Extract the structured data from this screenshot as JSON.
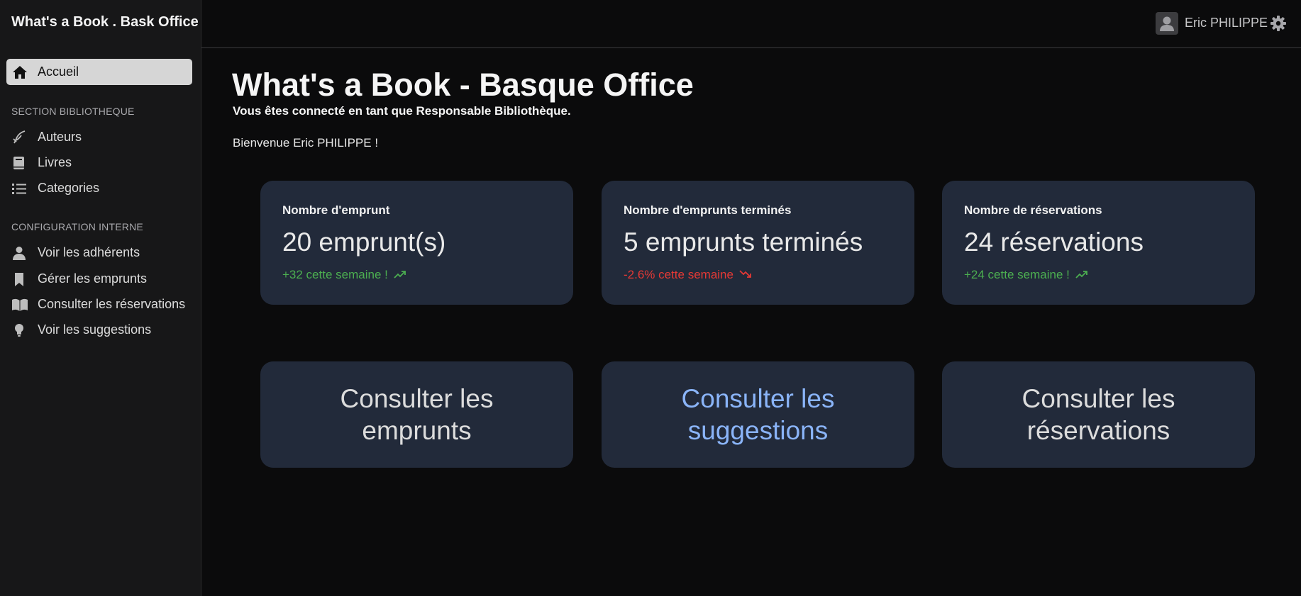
{
  "brand": "What's a Book . Bask Office",
  "sidebar": {
    "active": {
      "label": "Accueil",
      "icon": "home-icon"
    },
    "sections": [
      {
        "title": "SECTION BIBLIOTHEQUE",
        "items": [
          {
            "label": "Auteurs",
            "icon": "quill-icon"
          },
          {
            "label": "Livres",
            "icon": "book-icon"
          },
          {
            "label": "Categories",
            "icon": "list-icon"
          }
        ]
      },
      {
        "title": "CONFIGURATION INTERNE",
        "items": [
          {
            "label": "Voir les adhérents",
            "icon": "person-icon"
          },
          {
            "label": "Gérer les emprunts",
            "icon": "bookmark-icon"
          },
          {
            "label": "Consulter les réservations",
            "icon": "open-book-icon"
          },
          {
            "label": "Voir les suggestions",
            "icon": "lightbulb-icon"
          }
        ]
      }
    ]
  },
  "topbar": {
    "user_name": "Eric PHILIPPE",
    "avatar_icon": "avatar-icon",
    "settings_icon": "gear-icon"
  },
  "main": {
    "title": "What's a Book - Basque Office",
    "connected_as": "Vous êtes connecté en tant que Responsable Bibliothèque.",
    "welcome": "Bienvenue Eric PHILIPPE !",
    "stats": [
      {
        "title": "Nombre d'emprunt",
        "value": "20 emprunt(s)",
        "trend": "+32 cette semaine !",
        "direction": "up",
        "color": "#4caf50"
      },
      {
        "title": "Nombre d'emprunts terminés",
        "value": "5 emprunts terminés",
        "trend": "-2.6% cette semaine",
        "direction": "down",
        "color": "#e53935"
      },
      {
        "title": "Nombre de réservations",
        "value": "24 réservations",
        "trend": "+24 cette semaine !",
        "direction": "up",
        "color": "#4caf50"
      }
    ],
    "actions": [
      {
        "label": "Consulter les emprunts"
      },
      {
        "label": "Consulter les suggestions"
      },
      {
        "label": "Consulter les réservations"
      }
    ]
  },
  "colors": {
    "background": "#0b0b0c",
    "sidebar": "#171718",
    "card": "#222a3a",
    "link": "#8ab4f8"
  }
}
